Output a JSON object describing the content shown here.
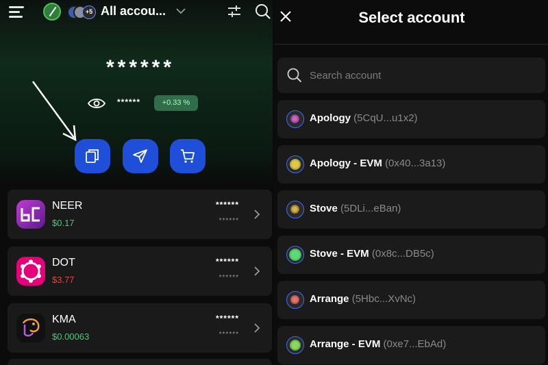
{
  "header": {
    "account_title": "All accou...",
    "extra_accounts_badge": "+5",
    "icons": [
      "menu-icon",
      "chevron-down-icon",
      "filter-icon",
      "search-icon"
    ]
  },
  "balance": {
    "total": "******",
    "sub": "******",
    "change": "+0.33 %"
  },
  "actions": [
    "copy-icon",
    "send-icon",
    "cart-icon"
  ],
  "tokens": [
    {
      "name": "NEER",
      "price": "$0.17",
      "price_color": "#3fcf7a",
      "balance": "******",
      "balance_value": "******"
    },
    {
      "name": "DOT",
      "price": "$3.77",
      "price_color": "#e0463f",
      "balance": "******",
      "balance_value": "******"
    },
    {
      "name": "KMA",
      "price": "$0.00063",
      "price_color": "#3fcf7a",
      "balance": "******",
      "balance_value": "******"
    }
  ],
  "select_panel": {
    "title": "Select account",
    "search_placeholder": "Search account",
    "accounts": [
      {
        "name": "Apology",
        "address": "(5CqU...u1x2)"
      },
      {
        "name": "Apology - EVM",
        "address": "(0x40...3a13)"
      },
      {
        "name": "Stove",
        "address": "(5DLi...eBan)"
      },
      {
        "name": "Stove - EVM",
        "address": "(0x8c...DB5c)"
      },
      {
        "name": "Arrange",
        "address": "(5Hbc...XvNc)"
      },
      {
        "name": "Arrange - EVM",
        "address": "(0xe7...EbAd)"
      }
    ]
  },
  "colors": {
    "accent_blue": "#1f4fd8",
    "positive": "#3fcf7a",
    "negative": "#e0463f"
  }
}
